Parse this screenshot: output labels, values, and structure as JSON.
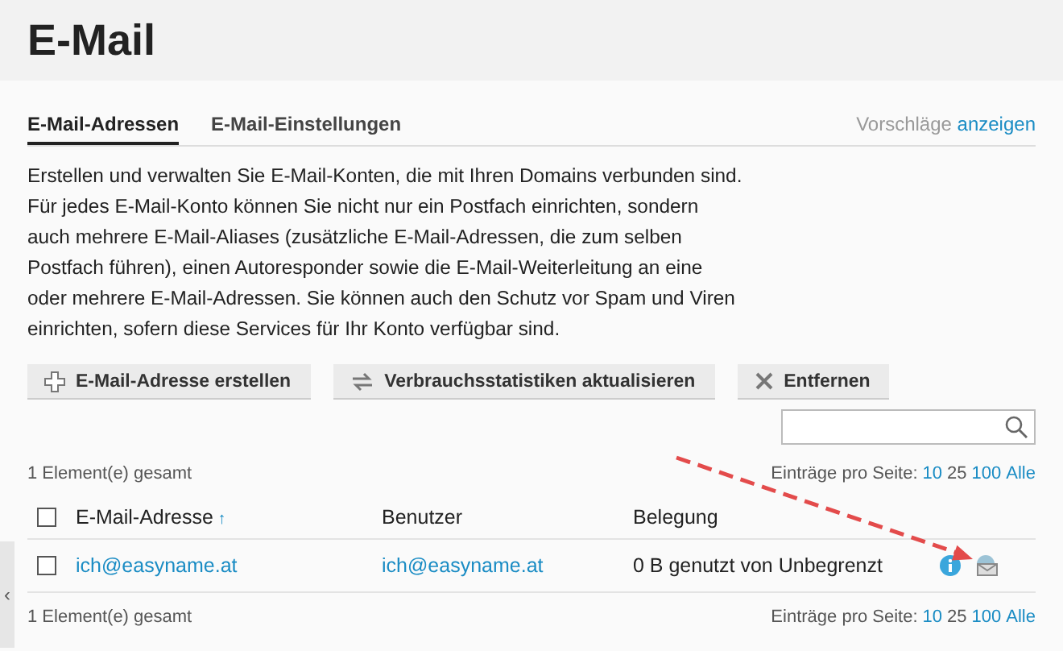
{
  "page": {
    "title": "E-Mail"
  },
  "tabs": [
    {
      "label": "E-Mail-Adressen",
      "selected": true
    },
    {
      "label": "E-Mail-Einstellungen",
      "selected": false
    }
  ],
  "suggestions": {
    "text": "Vorschläge",
    "link": "anzeigen"
  },
  "description": "Erstellen und verwalten Sie E-Mail-Konten, die mit Ihren Domains verbunden sind. Für jedes E-Mail-Konto können Sie nicht nur ein Postfach einrichten, sondern auch mehrere E-Mail-Aliases (zusätzliche E-Mail-Adressen, die zum selben Postfach führen), einen Autoresponder sowie die E-Mail-Weiterleitung an eine oder mehrere E-Mail-Adressen. Sie können auch den Schutz vor Spam und Viren einrichten, sofern diese Services für Ihr Konto verfügbar sind.",
  "toolbar": [
    {
      "label": "E-Mail-Adresse erstellen",
      "kind": "add"
    },
    {
      "label": "Verbrauchsstatistiken aktualisieren",
      "kind": "refresh"
    },
    {
      "label": "Entfernen",
      "kind": "remove"
    }
  ],
  "pager_top": {
    "total": "1 Element(e) gesamt",
    "label": "Einträge pro Seite:",
    "sizes": [
      {
        "label": "10",
        "selected": false
      },
      {
        "label": "25",
        "selected": true
      },
      {
        "label": "100",
        "selected": false
      },
      {
        "label": "Alle",
        "selected": false
      }
    ]
  },
  "table": {
    "select_all_checked": false,
    "columns": [
      {
        "label": "E-Mail-Adresse",
        "sort": "↑"
      },
      {
        "label": "Benutzer"
      },
      {
        "label": "Belegung"
      }
    ],
    "rows": [
      {
        "checked": false,
        "address": "ich@easyname.at",
        "user": "ich@easyname.at",
        "usage": "0 B genutzt von Unbegrenzt"
      }
    ]
  },
  "pager_bottom": {
    "total": "1 Element(e) gesamt",
    "label": "Einträge pro Seite:",
    "sizes": [
      {
        "label": "10",
        "selected": false
      },
      {
        "label": "25",
        "selected": true
      },
      {
        "label": "100",
        "selected": false
      },
      {
        "label": "Alle",
        "selected": false
      }
    ]
  },
  "sidebar_toggle": "‹"
}
